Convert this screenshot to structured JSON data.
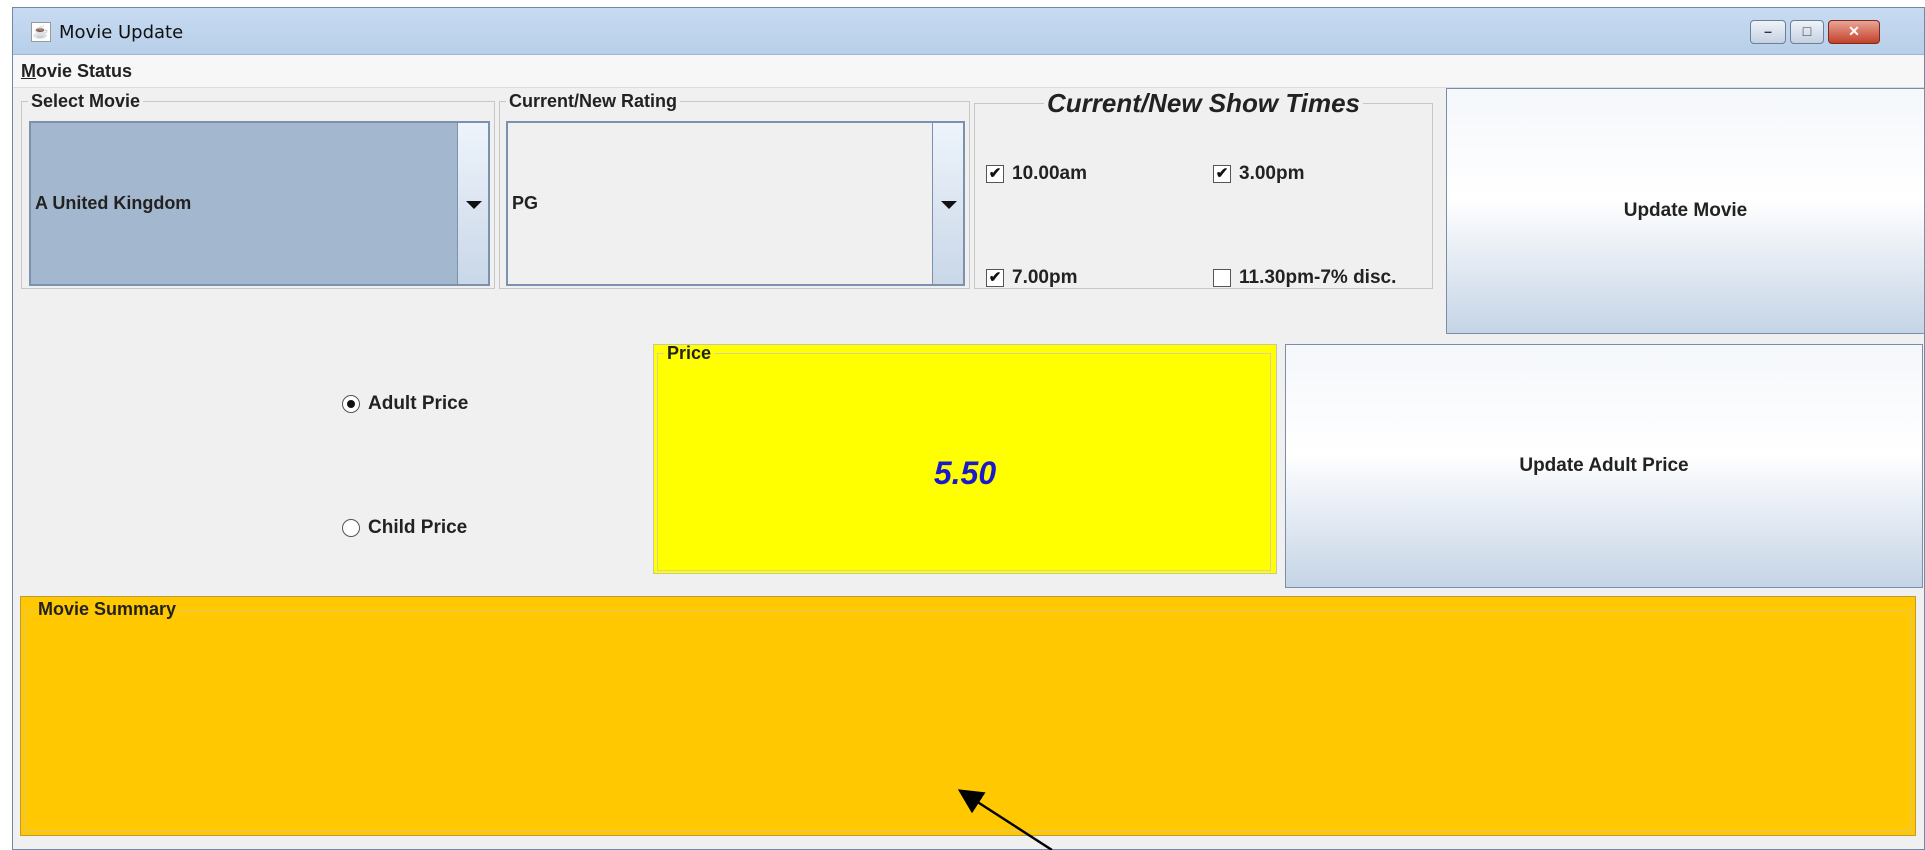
{
  "window": {
    "title": "Movie Update",
    "controls": {
      "minimize": "–",
      "maximize": "□",
      "close": "✕"
    }
  },
  "menubar": {
    "menu_underlined_letter": "M",
    "menu_rest": "ovie Status"
  },
  "select_movie": {
    "legend": "Select Movie",
    "value": "A United Kingdom"
  },
  "rating": {
    "legend": "Current/New Rating",
    "value": "PG"
  },
  "show_times": {
    "legend": "Current/New Show Times",
    "options": [
      {
        "label": "10.00am",
        "checked": true
      },
      {
        "label": "3.00pm",
        "checked": true
      },
      {
        "label": "7.00pm",
        "checked": true
      },
      {
        "label": "11.30pm-7% disc.",
        "checked": false
      }
    ],
    "check_mark": "✔"
  },
  "buttons": {
    "update_movie": "Update Movie",
    "update_adult_price": "Update Adult Price"
  },
  "price_type": {
    "adult_label": "Adult Price",
    "child_label": "Child Price",
    "selected": "adult"
  },
  "price": {
    "legend": "Price",
    "value": "5.50"
  },
  "summary": {
    "legend": "Movie Summary",
    "text": ""
  },
  "colors": {
    "price_bg": "#ffff00",
    "summary_bg": "#ffc800",
    "price_text": "#1a1acc"
  }
}
